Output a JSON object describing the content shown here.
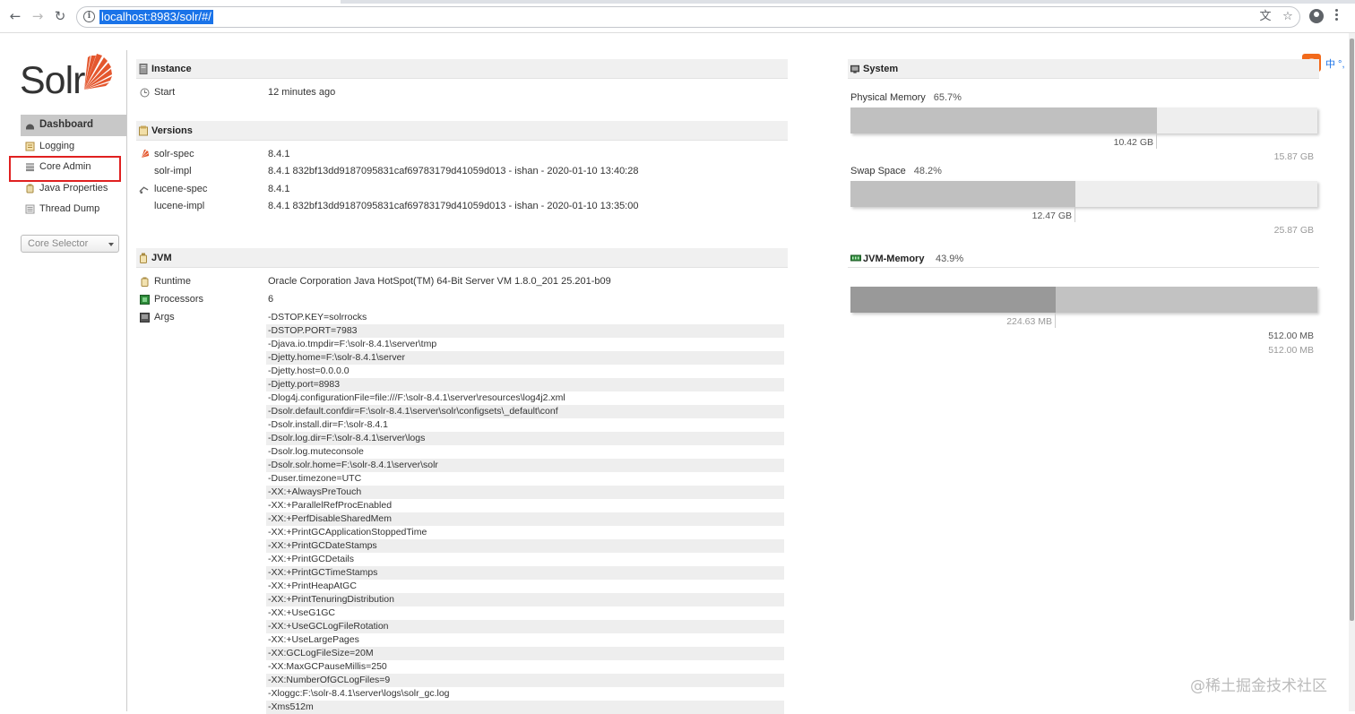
{
  "browser": {
    "url": "localhost:8983/solr/#/",
    "back_icon": "←",
    "forward_icon": "→",
    "reload_icon": "↻",
    "translate_icon": "文",
    "star_icon": "☆"
  },
  "ime": {
    "s": "S",
    "text": "中 °,"
  },
  "logo": {
    "text": "Solr"
  },
  "sidebar": {
    "items": [
      {
        "label": "Dashboard",
        "icon": "dashboard-icon"
      },
      {
        "label": "Logging",
        "icon": "logging-icon"
      },
      {
        "label": "Core Admin",
        "icon": "core-admin-icon"
      },
      {
        "label": "Java Properties",
        "icon": "java-properties-icon"
      },
      {
        "label": "Thread Dump",
        "icon": "thread-dump-icon"
      }
    ],
    "core_selector": "Core Selector"
  },
  "instance": {
    "title": "Instance",
    "start_label": "Start",
    "start_value": "12 minutes ago"
  },
  "versions": {
    "title": "Versions",
    "rows": [
      {
        "label": "solr-spec",
        "value": "8.4.1"
      },
      {
        "label": "solr-impl",
        "value": "8.4.1 832bf13dd9187095831caf69783179d41059d013 - ishan - 2020-01-10 13:40:28"
      },
      {
        "label": "lucene-spec",
        "value": "8.4.1"
      },
      {
        "label": "lucene-impl",
        "value": "8.4.1 832bf13dd9187095831caf69783179d41059d013 - ishan - 2020-01-10 13:35:00"
      }
    ]
  },
  "jvm": {
    "title": "JVM",
    "runtime_label": "Runtime",
    "runtime_value": "Oracle Corporation Java HotSpot(TM) 64-Bit Server VM 1.8.0_201 25.201-b09",
    "processors_label": "Processors",
    "processors_value": "6",
    "args_label": "Args",
    "args": [
      "-DSTOP.KEY=solrrocks",
      "-DSTOP.PORT=7983",
      "-Djava.io.tmpdir=F:\\solr-8.4.1\\server\\tmp",
      "-Djetty.home=F:\\solr-8.4.1\\server",
      "-Djetty.host=0.0.0.0",
      "-Djetty.port=8983",
      "-Dlog4j.configurationFile=file:///F:\\solr-8.4.1\\server\\resources\\log4j2.xml",
      "-Dsolr.default.confdir=F:\\solr-8.4.1\\server\\solr\\configsets\\_default\\conf",
      "-Dsolr.install.dir=F:\\solr-8.4.1",
      "-Dsolr.log.dir=F:\\solr-8.4.1\\server\\logs",
      "-Dsolr.log.muteconsole",
      "-Dsolr.solr.home=F:\\solr-8.4.1\\server\\solr",
      "-Duser.timezone=UTC",
      "-XX:+AlwaysPreTouch",
      "-XX:+ParallelRefProcEnabled",
      "-XX:+PerfDisableSharedMem",
      "-XX:+PrintGCApplicationStoppedTime",
      "-XX:+PrintGCDateStamps",
      "-XX:+PrintGCDetails",
      "-XX:+PrintGCTimeStamps",
      "-XX:+PrintHeapAtGC",
      "-XX:+PrintTenuringDistribution",
      "-XX:+UseG1GC",
      "-XX:+UseGCLogFileRotation",
      "-XX:+UseLargePages",
      "-XX:GCLogFileSize=20M",
      "-XX:MaxGCPauseMillis=250",
      "-XX:NumberOfGCLogFiles=9",
      "-Xloggc:F:\\solr-8.4.1\\server\\logs\\solr_gc.log",
      "-Xms512m"
    ]
  },
  "system": {
    "title": "System",
    "physical": {
      "label": "Physical Memory",
      "pct": "65.7%",
      "fraction": 0.657,
      "used": "10.42 GB",
      "total": "15.87 GB"
    },
    "swap": {
      "label": "Swap Space",
      "pct": "48.2%",
      "fraction": 0.482,
      "used": "12.47 GB",
      "total": "25.87 GB"
    }
  },
  "jvm_memory": {
    "title": "JVM-Memory",
    "pct": "43.9%",
    "used_fraction": 0.439,
    "used": "224.63 MB",
    "committed": "512.00 MB",
    "max": "512.00 MB"
  },
  "watermark": "@稀土掘金技术社区"
}
